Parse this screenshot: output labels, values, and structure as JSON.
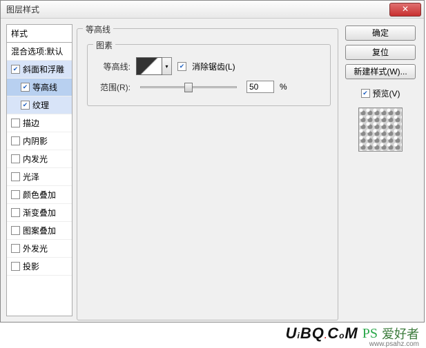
{
  "title": "图层样式",
  "styles_header": "样式",
  "blend_options": "混合选项:默认",
  "styles": [
    {
      "label": "斜面和浮雕",
      "checked": true,
      "highlight": true
    },
    {
      "label": "等高线",
      "checked": true,
      "sub": true,
      "selected": true
    },
    {
      "label": "纹理",
      "checked": true,
      "sub": true,
      "highlight": true
    },
    {
      "label": "描边",
      "checked": false
    },
    {
      "label": "内阴影",
      "checked": false
    },
    {
      "label": "内发光",
      "checked": false
    },
    {
      "label": "光泽",
      "checked": false
    },
    {
      "label": "颜色叠加",
      "checked": false
    },
    {
      "label": "渐变叠加",
      "checked": false
    },
    {
      "label": "图案叠加",
      "checked": false
    },
    {
      "label": "外发光",
      "checked": false
    },
    {
      "label": "投影",
      "checked": false
    }
  ],
  "outer_group_title": "等高线",
  "inner_group_title": "图素",
  "contour_label": "等高线:",
  "antialias_label": "消除锯齿(L)",
  "antialias_checked": true,
  "range_label": "范围(R):",
  "range_value": "50",
  "range_unit": "%",
  "buttons": {
    "ok": "确定",
    "cancel": "复位",
    "new_style": "新建样式(W)..."
  },
  "preview_label": "预览(V)",
  "preview_checked": true,
  "watermark": {
    "uibq": "UiBQ.CoM",
    "ps": "PS",
    "cn": "爱好者",
    "url": "www.psahz.com"
  }
}
